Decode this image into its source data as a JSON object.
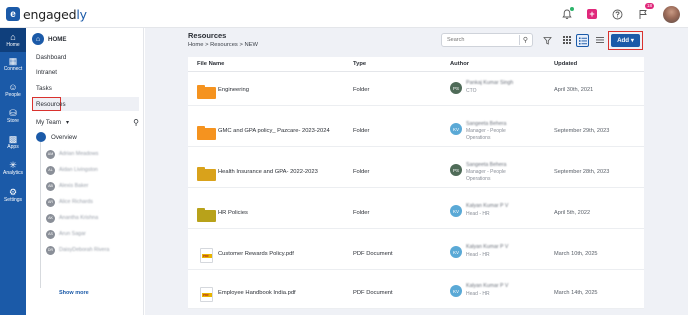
{
  "brand": {
    "logo_prefix": "engaged",
    "logo_suffix": "ly",
    "logo_mark": "e"
  },
  "topbar": {
    "icons": [
      "bell-icon",
      "add-icon",
      "help-icon",
      "flag-icon"
    ],
    "add_glyph": "+",
    "notification_count": "18"
  },
  "rail": [
    {
      "label": "Home",
      "icon": "home-icon"
    },
    {
      "label": "Connect",
      "icon": "connect-icon"
    },
    {
      "label": "People",
      "icon": "people-icon"
    },
    {
      "label": "Store",
      "icon": "store-icon"
    },
    {
      "label": "Apps",
      "icon": "apps-icon"
    },
    {
      "label": "Analytics",
      "icon": "analytics-icon"
    },
    {
      "label": "Settings",
      "icon": "settings-icon"
    }
  ],
  "nav": {
    "home_label": "HOME",
    "links": [
      "Dashboard",
      "Intranet",
      "Tasks",
      "Resources"
    ],
    "my_team_label": "My Team",
    "overview_label": "Overview",
    "members": [
      {
        "initials": "AM",
        "name": "Adrian Meadows"
      },
      {
        "initials": "AL",
        "name": "Aidan Livingston"
      },
      {
        "initials": "AB",
        "name": "Alexis Baker"
      },
      {
        "initials": "AR",
        "name": "Alice Richards"
      },
      {
        "initials": "AK",
        "name": "Anantha Krishna"
      },
      {
        "initials": "AS",
        "name": "Arun Sagar"
      },
      {
        "initials": "DR",
        "name": "DaisyDeborah Rivera"
      }
    ],
    "show_more": "Show more"
  },
  "main": {
    "title": "Resources",
    "breadcrumb": [
      "Home",
      "Resources",
      "NEW"
    ],
    "breadcrumb_sep": ">",
    "search_placeholder": "Search",
    "add_label": "Add",
    "columns": [
      "File Name",
      "Type",
      "Author",
      "Updated"
    ],
    "rows": [
      {
        "icon": "folder-icon",
        "folder_color": "#f5931f",
        "name": "Engineering",
        "type": "Folder",
        "author_initials": "PS",
        "author_color": "#4f6b58",
        "author_name": "Pankaj Kumar Singh",
        "author_role": "CTO",
        "updated": "April 30th, 2021"
      },
      {
        "icon": "folder-icon",
        "folder_color": "#f5931f",
        "name": "GMC and GPA policy_ Pazcare- 2023-2024",
        "type": "Folder",
        "author_initials": "KV",
        "author_color": "#5aa9d6",
        "author_name": "Sangeeta Behera",
        "author_role": "Manager - People Operations",
        "updated": "September 29th, 2023"
      },
      {
        "icon": "folder-icon",
        "folder_color": "#d9a21b",
        "name": "Health Insurance and GPA- 2022-2023",
        "type": "Folder",
        "author_initials": "PS",
        "author_color": "#4f6b58",
        "author_name": "Sangeeta Behera",
        "author_role": "Manager - People Operations",
        "updated": "September 28th, 2023"
      },
      {
        "icon": "folder-icon",
        "folder_color": "#b8a21a",
        "name": "HR Policies",
        "type": "Folder",
        "author_initials": "KV",
        "author_color": "#5aa9d6",
        "author_name": "Kalyan Kumar P V",
        "author_role": "Head - HR",
        "updated": "April 5th, 2022"
      },
      {
        "icon": "pdf-icon",
        "name": "Customer Rewards Policy.pdf",
        "type": "PDF Document",
        "author_initials": "KV",
        "author_color": "#5aa9d6",
        "author_name": "Kalyan Kumar P V",
        "author_role": "Head - HR",
        "updated": "March 10th, 2025"
      },
      {
        "icon": "pdf-icon",
        "name": "Employee Handbook India.pdf",
        "type": "PDF Document",
        "author_initials": "KV",
        "author_color": "#5aa9d6",
        "author_name": "Kalyan Kumar P V",
        "author_role": "Head - HR",
        "updated": "March 14th, 2025"
      }
    ],
    "pdf_label": "PDF"
  },
  "colors": {
    "primary": "#1b5aa8",
    "highlight": "#d9322e",
    "accent_pink": "#e0287b"
  }
}
